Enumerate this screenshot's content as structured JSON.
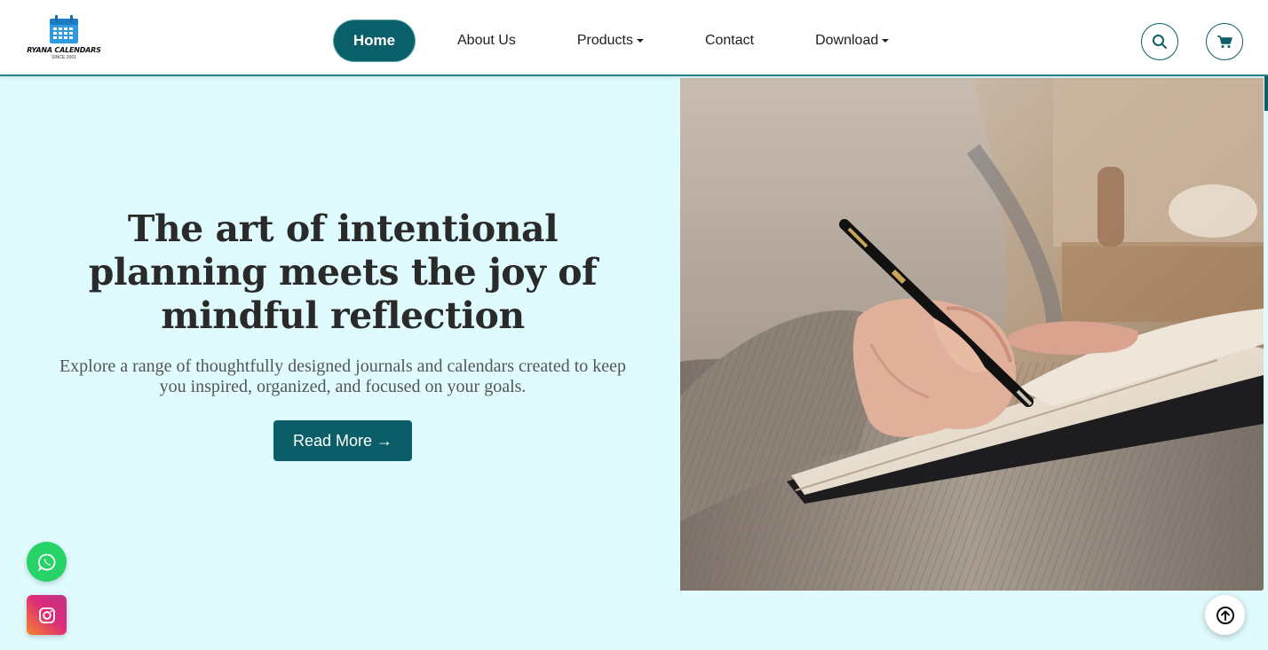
{
  "brand": {
    "name": "RYANA CALENDARS",
    "since": "SINCE 2001"
  },
  "nav": {
    "items": [
      {
        "label": "Home",
        "active": true
      },
      {
        "label": "About Us",
        "dropdown": false
      },
      {
        "label": "Products",
        "dropdown": true
      },
      {
        "label": "Contact",
        "dropdown": false
      },
      {
        "label": "Download",
        "dropdown": true
      }
    ]
  },
  "header_icons": [
    "search-icon",
    "cart-icon"
  ],
  "hero": {
    "title": "The art of intentional planning meets the joy of mindful reflection",
    "subtitle": "Explore a range of thoughtfully designed journals and calendars created to keep you inspired, organized, and focused on your goals.",
    "cta_label": "Read More →"
  },
  "floating": [
    "whatsapp-icon",
    "instagram-icon",
    "scroll-to-top-icon"
  ],
  "colors": {
    "primary": "#0b5e67",
    "hero_bg": "#e0fbfd",
    "whatsapp": "#25d366"
  }
}
